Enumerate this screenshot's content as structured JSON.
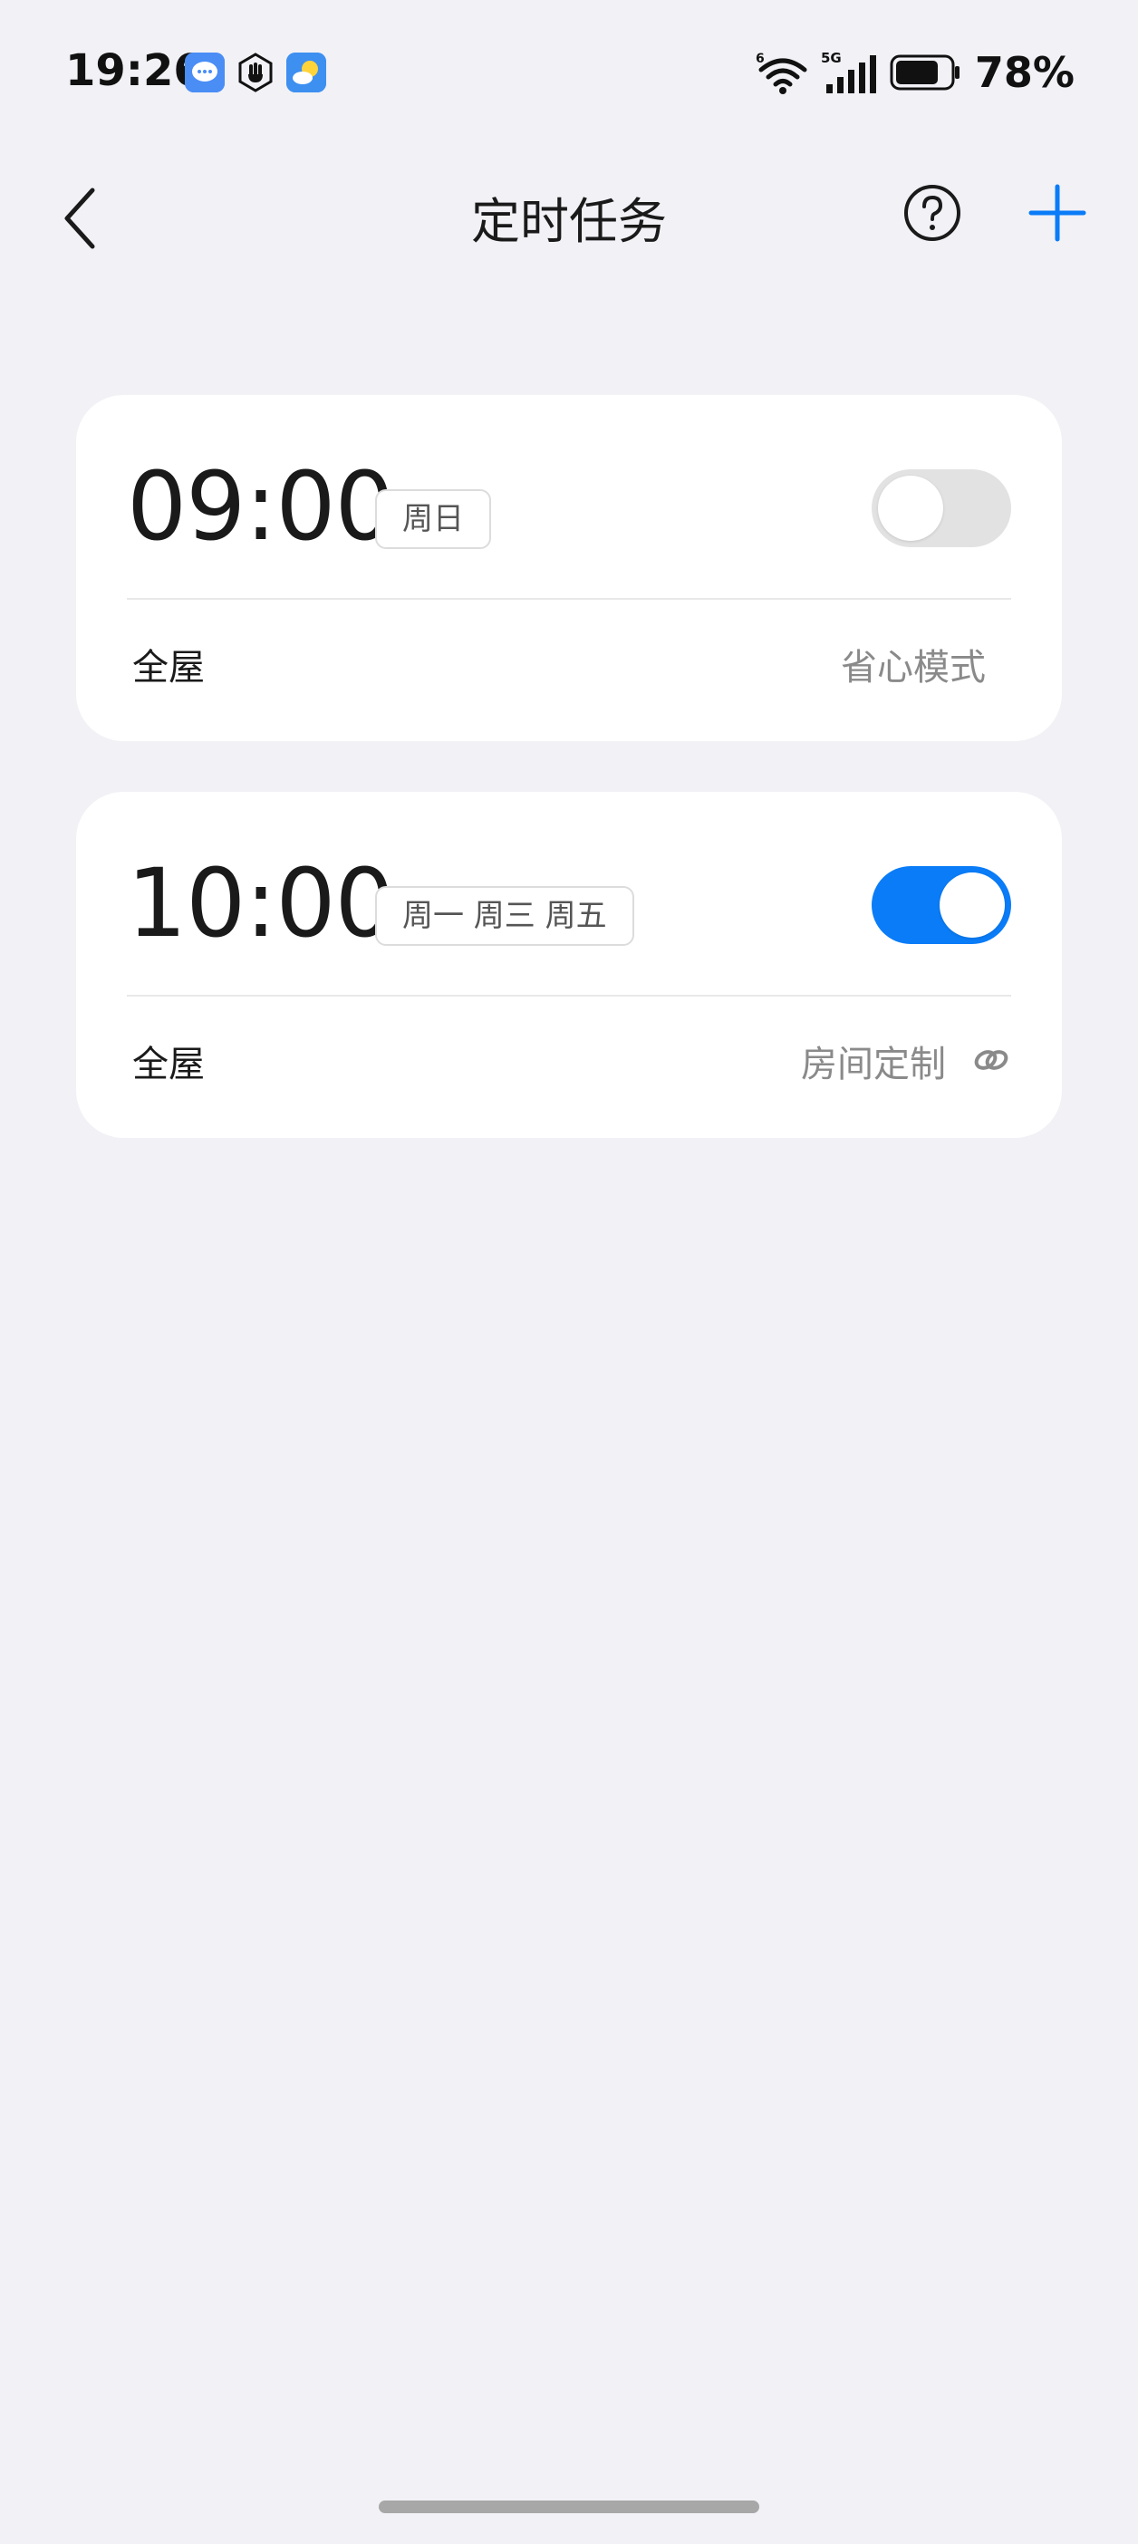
{
  "status_bar": {
    "time": "19:26",
    "battery_text": "78%"
  },
  "header": {
    "title": "定时任务"
  },
  "tasks": [
    {
      "time": "09:00",
      "repeat": "周日",
      "enabled": false,
      "scope": "全屋",
      "mode": "省心模式"
    },
    {
      "time": "10:00",
      "repeat": "周一 周三 周五",
      "enabled": true,
      "scope": "全屋",
      "mode": "房间定制"
    }
  ],
  "colors": {
    "accent": "#0a7cf7",
    "background": "#f1f1f6",
    "card": "#ffffff",
    "toggle_off": "#e2e2e2"
  },
  "icons": {
    "back": "chevron-left-icon",
    "help": "question-circle-icon",
    "add": "plus-icon",
    "link": "link-icon"
  }
}
